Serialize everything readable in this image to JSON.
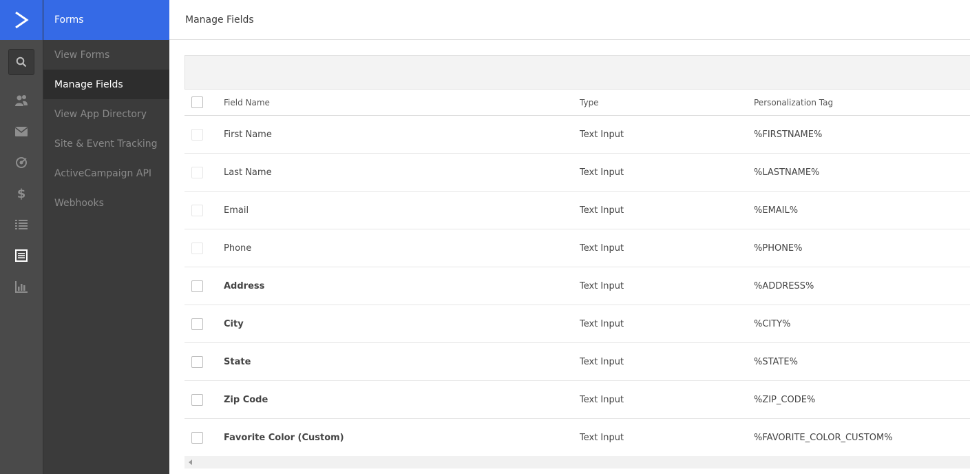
{
  "app": {
    "section_title": "Forms",
    "page_title": "Manage Fields"
  },
  "rail": {
    "logo_icon": "activecampaign-chevron-logo",
    "icons": [
      "search-icon",
      "contacts-icon",
      "mail-icon",
      "target-icon",
      "dollar-icon",
      "list-icon",
      "forms-icon",
      "reports-icon"
    ]
  },
  "subnav": {
    "items": [
      {
        "label": "View Forms"
      },
      {
        "label": "Manage Fields"
      },
      {
        "label": "View App Directory"
      },
      {
        "label": "Site & Event Tracking"
      },
      {
        "label": "ActiveCampaign API"
      },
      {
        "label": "Webhooks"
      }
    ],
    "active_index": 1
  },
  "table": {
    "headers": {
      "name": "Field Name",
      "type": "Type",
      "tag": "Personalization Tag"
    },
    "rows": [
      {
        "name": "First Name",
        "type": "Text Input",
        "tag": "%FIRSTNAME%",
        "system": true
      },
      {
        "name": "Last Name",
        "type": "Text Input",
        "tag": "%LASTNAME%",
        "system": true
      },
      {
        "name": "Email",
        "type": "Text Input",
        "tag": "%EMAIL%",
        "system": true
      },
      {
        "name": "Phone",
        "type": "Text Input",
        "tag": "%PHONE%",
        "system": true
      },
      {
        "name": "Address",
        "type": "Text Input",
        "tag": "%ADDRESS%",
        "system": false
      },
      {
        "name": "City",
        "type": "Text Input",
        "tag": "%CITY%",
        "system": false
      },
      {
        "name": "State",
        "type": "Text Input",
        "tag": "%STATE%",
        "system": false
      },
      {
        "name": "Zip Code",
        "type": "Text Input",
        "tag": "%ZIP_CODE%",
        "system": false
      },
      {
        "name": "Favorite Color (Custom)",
        "type": "Text Input",
        "tag": "%FAVORITE_COLOR_CUSTOM%",
        "system": false
      }
    ]
  },
  "colors": {
    "brand": "#356ae6",
    "rail": "#4a4a4a",
    "subnav": "#3b3b3b",
    "subnav_active": "#2d2d2d"
  }
}
